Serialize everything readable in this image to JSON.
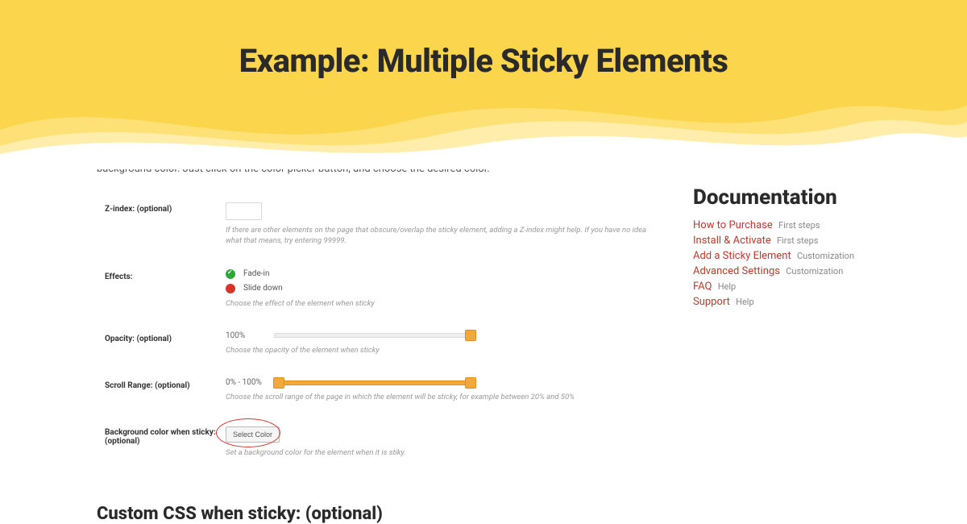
{
  "hero": {
    "title": "Example: Multiple Sticky Elements"
  },
  "intro": {
    "cutoff": "",
    "line2": "background color. Just click on the color picker button, and choose the desired color."
  },
  "settings": {
    "zindex": {
      "label": "Z-index: (optional)",
      "hint": "If there are other elements on the page that obscure/overlap the sticky element, adding a Z-index might help. If you have no idea what that means, try entering 99999."
    },
    "effects": {
      "label": "Effects:",
      "opt1": "Fade-in",
      "opt2": "Slide down",
      "hint": "Choose the effect of the element when sticky"
    },
    "opacity": {
      "label": "Opacity: (optional)",
      "value": "100%",
      "hint": "Choose the opacity of the element when sticky"
    },
    "scroll": {
      "label": "Scroll Range: (optional)",
      "value": "0% - 100%",
      "hint": "Choose the scroll range of the page in which the element will be sticky, for example between 20% and 50%"
    },
    "bgcolor": {
      "label": "Background color when sticky: (optional)",
      "button": "Select Color",
      "hint": "Set a background color for the element when it is stiky."
    }
  },
  "section_heading": "Custom CSS when sticky: (optional)",
  "sidebar": {
    "title": "Documentation",
    "items": [
      {
        "label": "How to Purchase",
        "cat": "First steps"
      },
      {
        "label": "Install & Activate",
        "cat": "First steps"
      },
      {
        "label": "Add a Sticky Element",
        "cat": "Customization"
      },
      {
        "label": "Advanced Settings",
        "cat": "Customization"
      },
      {
        "label": "FAQ",
        "cat": "Help"
      },
      {
        "label": "Support",
        "cat": "Help"
      }
    ]
  }
}
